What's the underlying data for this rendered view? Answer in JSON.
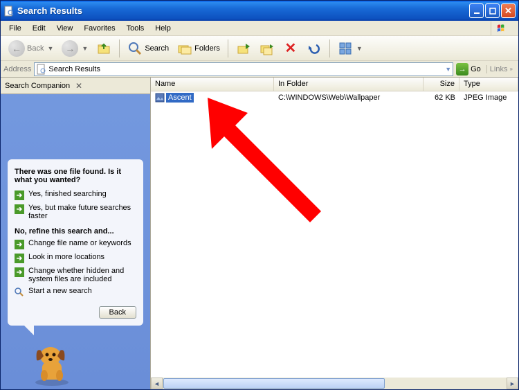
{
  "window": {
    "title": "Search Results"
  },
  "menu": {
    "file": "File",
    "edit": "Edit",
    "view": "View",
    "favorites": "Favorites",
    "tools": "Tools",
    "help": "Help"
  },
  "toolbar": {
    "back": "Back",
    "search": "Search",
    "folders": "Folders"
  },
  "address": {
    "label": "Address",
    "value": "Search Results",
    "go": "Go",
    "links": "Links"
  },
  "companion": {
    "header": "Search Companion",
    "headline": "There was one file found.  Is it what you wanted?",
    "yes_done": "Yes, finished searching",
    "yes_faster": "Yes, but make future searches faster",
    "refine_h": "No, refine this search and...",
    "refine_name": "Change file name or keywords",
    "refine_loc": "Look in more locations",
    "refine_hidden": "Change whether hidden and system files are included",
    "new_search": "Start a new search",
    "back": "Back"
  },
  "columns": {
    "name": "Name",
    "folder": "In Folder",
    "size": "Size",
    "type": "Type"
  },
  "result": {
    "name": "Ascent",
    "folder": "C:\\WINDOWS\\Web\\Wallpaper",
    "size": "62 KB",
    "type": "JPEG Image"
  }
}
